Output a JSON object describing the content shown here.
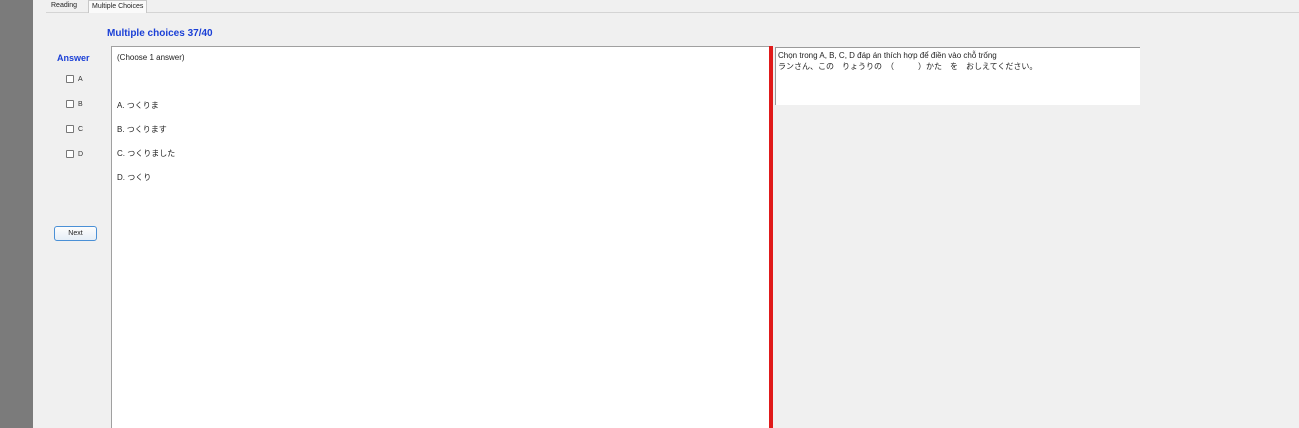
{
  "tabs": [
    {
      "label": "Reading"
    },
    {
      "label": "Multiple Choices"
    }
  ],
  "title": "Multiple choices 37/40",
  "answer": {
    "label": "Answer",
    "options": [
      "A",
      "B",
      "C",
      "D"
    ]
  },
  "next_label": "Next",
  "question": {
    "instruction": "(Choose 1 answer)",
    "choices": [
      "A. つくりま",
      "B. つくります",
      "C. つくりました",
      "D. つくり"
    ]
  },
  "prompt": {
    "line1": "Chọn trong A, B, C, D đáp án thích hợp để điền vào chỗ trống",
    "line2": "ランさん、この　りょうりの　（　　　）かた　を　おしえてください。"
  },
  "colors": {
    "accent_blue": "#1a3fd6",
    "divider_red": "#e01a1a",
    "left_strip": "#7b7b7b"
  }
}
